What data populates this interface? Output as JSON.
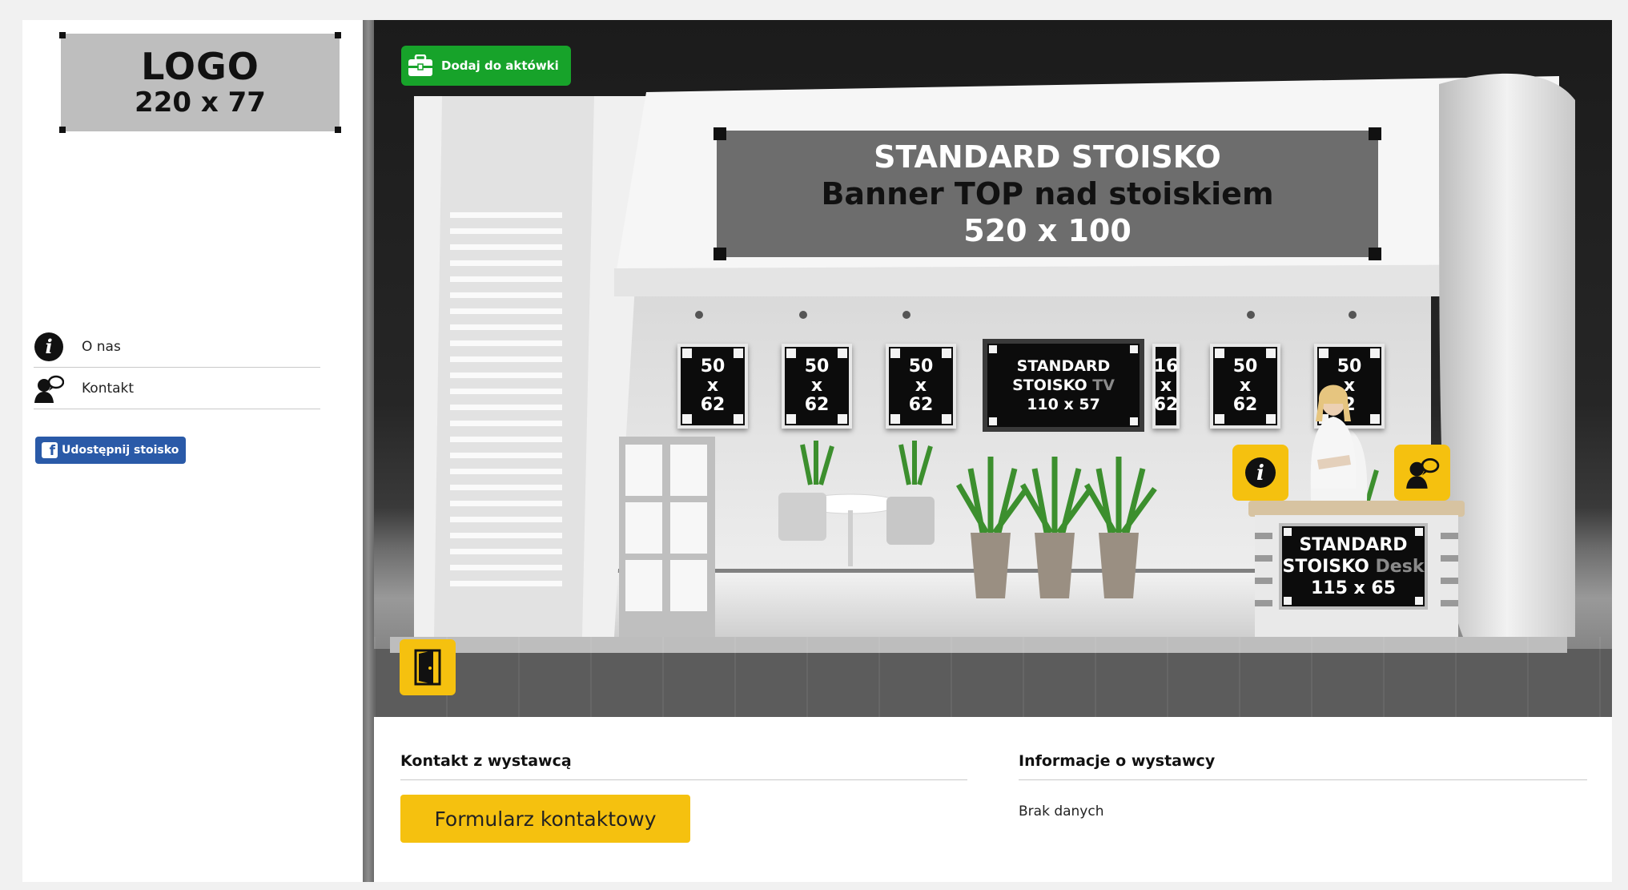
{
  "sidebar": {
    "logo": {
      "line1": "LOGO",
      "line2": "220 x 77"
    },
    "menu": [
      {
        "label": "O nas",
        "icon": "info-icon"
      },
      {
        "label": "Kontakt",
        "icon": "contact-icon"
      }
    ],
    "share_button": "Udostępnij stoisko"
  },
  "stand": {
    "add_button": "Dodaj do aktówki",
    "banner_top": {
      "line1": "STANDARD STOISKO",
      "line2": "Banner TOP nad stoiskiem",
      "line3": "520 x 100"
    },
    "posters": [
      {
        "w": "50",
        "x": "x",
        "h": "62"
      },
      {
        "w": "50",
        "x": "x",
        "h": "62"
      },
      {
        "w": "50",
        "x": "x",
        "h": "62"
      },
      {
        "w": "16",
        "x": "x",
        "h": "62"
      },
      {
        "w": "50",
        "x": "x",
        "h": "62"
      },
      {
        "w": "50",
        "x": "x",
        "h": "2"
      }
    ],
    "tv": {
      "line1": "STANDARD",
      "line2a": "STOISKO",
      "line2b": "TV",
      "line3": "110 x 57"
    },
    "desk": {
      "line1": "STANDARD",
      "line2a": "STOISKO",
      "line2b": "Desk",
      "line3": "115 x 65"
    }
  },
  "contact_section": {
    "title": "Kontakt z wystawcą",
    "button": "Formularz kontaktowy"
  },
  "info_section": {
    "title": "Informacje o wystawcy",
    "text": "Brak danych"
  },
  "colors": {
    "accent_yellow": "#f5c10f",
    "green": "#17a32a",
    "facebook_blue": "#2a5aa8"
  }
}
